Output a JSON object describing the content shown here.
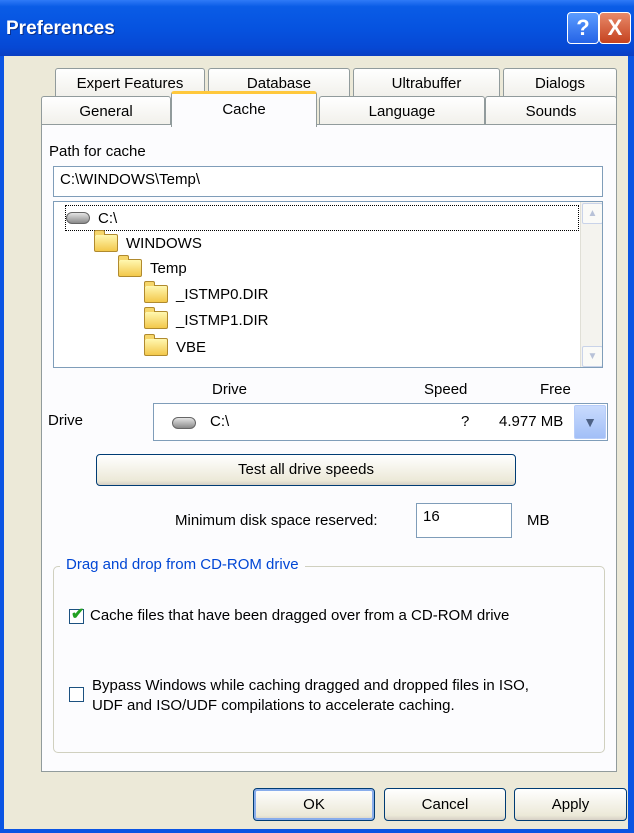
{
  "window": {
    "title": "Preferences",
    "help": "?",
    "close": "X"
  },
  "tabs": {
    "row1": [
      "Expert Features",
      "Database",
      "Ultrabuffer",
      "Dialogs"
    ],
    "row2": [
      "General",
      "Cache",
      "Language",
      "Sounds"
    ],
    "active": "Cache"
  },
  "cache": {
    "path_label": "Path for cache",
    "path_value": "C:\\WINDOWS\\Temp\\",
    "tree": [
      {
        "label": "C:\\",
        "type": "drive"
      },
      {
        "label": "WINDOWS",
        "type": "folder"
      },
      {
        "label": "Temp",
        "type": "folder"
      },
      {
        "label": "_ISTMP0.DIR",
        "type": "folder"
      },
      {
        "label": "_ISTMP1.DIR",
        "type": "folder"
      },
      {
        "label": "VBE",
        "type": "folder"
      }
    ],
    "drive_header": {
      "drive": "Drive",
      "speed": "Speed",
      "free": "Free"
    },
    "drive_label": "Drive",
    "drive_selected": {
      "name": "C:\\",
      "speed": "?",
      "free": "4.977 MB"
    },
    "test_button": "Test all drive speeds",
    "min_space_label": "Minimum disk space reserved:",
    "min_space_value": "16",
    "min_space_unit": "MB",
    "cdrom_group": "Drag and drop from CD-ROM drive",
    "option1": {
      "label": "Cache files that have been dragged over from a CD-ROM drive",
      "checked": true
    },
    "option2": {
      "label_line1": "Bypass Windows while caching dragged and dropped files in ISO,",
      "label_line2": "UDF and ISO/UDF compilations to accelerate caching.",
      "checked": false
    }
  },
  "buttons": {
    "ok": "OK",
    "cancel": "Cancel",
    "apply": "Apply"
  },
  "icons": {
    "drive": "hard-drive-icon",
    "folder": "folder-icon",
    "checkmark": "checkmark-icon",
    "dropdown": "chevron-down-icon"
  }
}
